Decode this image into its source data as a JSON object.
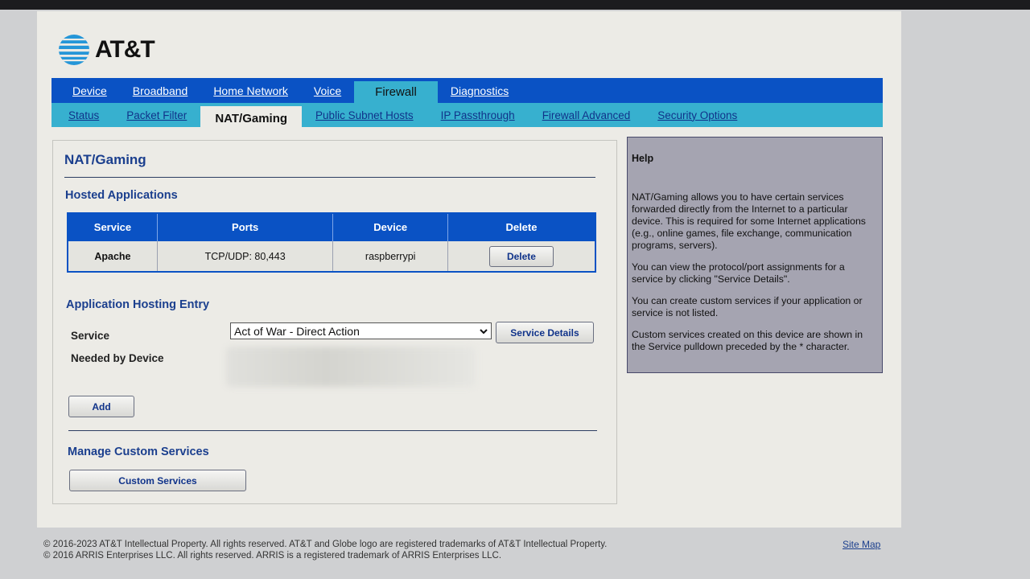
{
  "brand": {
    "name": "AT&T",
    "globe_color": "#2596d8"
  },
  "nav": {
    "primary": [
      "Device",
      "Broadband",
      "Home Network",
      "Voice",
      "Firewall",
      "Diagnostics"
    ],
    "primary_active": "Firewall",
    "secondary": [
      "Status",
      "Packet Filter",
      "NAT/Gaming",
      "Public Subnet Hosts",
      "IP Passthrough",
      "Firewall Advanced",
      "Security Options"
    ],
    "secondary_active": "NAT/Gaming"
  },
  "main": {
    "title": "NAT/Gaming",
    "hosted_heading": "Hosted Applications",
    "table": {
      "columns": [
        "Service",
        "Ports",
        "Device",
        "Delete"
      ],
      "rows": [
        {
          "service": "Apache",
          "ports": "TCP/UDP: 80,443",
          "device": "raspberrypi",
          "delete_label": "Delete"
        }
      ]
    },
    "entry_heading": "Application Hosting Entry",
    "service_label": "Service",
    "service_selected": "Act of War - Direct Action",
    "service_details_label": "Service Details",
    "needed_by_label": "Needed by Device",
    "add_label": "Add",
    "custom_heading": "Manage Custom Services",
    "custom_button_label": "Custom Services"
  },
  "help": {
    "title": "Help",
    "paragraphs": [
      "NAT/Gaming allows you to have certain services forwarded directly from the Internet to a particular device. This is required for some Internet applications (e.g., online games, file exchange, communication programs, servers).",
      "You can view the protocol/port assignments for a service by clicking \"Service Details\".",
      "You can create custom services if your application or service is not listed.",
      "Custom services created on this device are shown in the Service pulldown preceded by the * character."
    ]
  },
  "footer": {
    "line1": "© 2016-2023 AT&T Intellectual Property. All rights reserved. AT&T and Globe logo are registered trademarks of AT&T Intellectual Property.",
    "line2": "© 2016 ARRIS Enterprises LLC. All rights reserved. ARRIS is a registered trademark of ARRIS Enterprises LLC.",
    "site_map": "Site Map"
  },
  "colors": {
    "nav_blue": "#0a52c4",
    "nav_teal": "#37b0cf",
    "heading_blue": "#1b3f8e",
    "help_bg": "#a5a4b1"
  }
}
